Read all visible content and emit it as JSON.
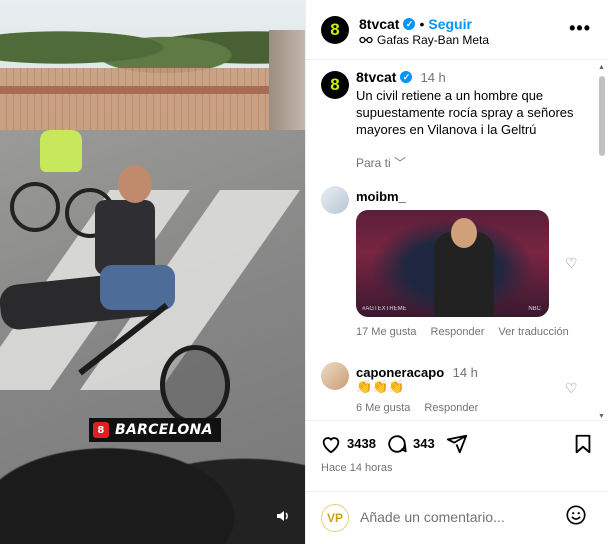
{
  "media": {
    "location_badge": "BARCELONA",
    "badge_logo": "8",
    "mute_icon": "speaker-icon"
  },
  "header": {
    "avatar_text": "8",
    "username": "8tvcat",
    "separator": "•",
    "follow_label": "Seguir",
    "subtitle": "Gafas Ray-Ban Meta",
    "more_label": "•••"
  },
  "caption": {
    "avatar_text": "8",
    "username": "8tvcat",
    "time": "14 h",
    "text": "Un civil retiene a un hombre que supuestamente rocía spray a señores mayores en Vilanova i la Geltrú",
    "translate_label": "Para ti"
  },
  "comments": [
    {
      "username": "moibm_",
      "gif_tag_left": "#AGTEXTREME",
      "gif_tag_right": "NBC",
      "likes": "17 Me gusta",
      "reply": "Responder",
      "translate": "Ver traducción"
    },
    {
      "username": "caponeracapo",
      "time": "14 h",
      "text": "👏👏👏",
      "likes": "6 Me gusta",
      "reply": "Responder"
    }
  ],
  "actions": {
    "likes_count": "3438",
    "comments_count": "343",
    "time_ago": "Hace 14 horas"
  },
  "comment_bar": {
    "avatar_text": "VP",
    "placeholder": "Añade un comentario..."
  },
  "colors": {
    "accent": "#0095f6",
    "brand_avatar_bg": "#000000",
    "brand_avatar_fg": "#c8f000",
    "muted_text": "#737373"
  }
}
